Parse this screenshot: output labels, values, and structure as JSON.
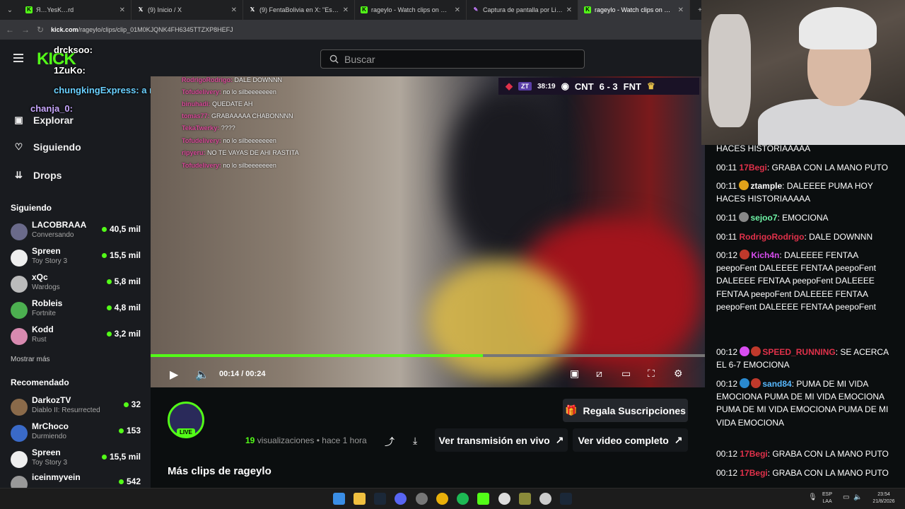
{
  "browser": {
    "tabs": [
      {
        "title": "Я…YesK…rd",
        "icon": "kick-icon",
        "active": false
      },
      {
        "title": "(9) Inicio / X",
        "icon": "x-icon",
        "active": false
      },
      {
        "title": "(9) FentaBolivia en X: \"Este tipo…",
        "icon": "x-icon",
        "active": false
      },
      {
        "title": "rageylo - Watch clips on Kick",
        "icon": "kick-icon",
        "active": false
      },
      {
        "title": "Captura de pantalla por Lightsh…",
        "icon": "lightshot-icon",
        "active": false
      },
      {
        "title": "rageylo - Watch clips on Kick",
        "icon": "kick-icon",
        "active": true
      }
    ],
    "url_host": "kick.com",
    "url_path": "/rageylo/clips/clip_01M0KJQNK4FH6345TTZXP8HEFJ",
    "new_tab": "+"
  },
  "overlay": {
    "users": [
      "drcksoo:",
      "1ZuKo:",
      "chungkingExpress: a no",
      "chanja_0:"
    ],
    "logo": "KICK"
  },
  "search": {
    "placeholder": "Buscar"
  },
  "nav": {
    "explore": "Explorar",
    "following": "Siguiendo",
    "drops": "Drops"
  },
  "following": {
    "title": "Siguiendo",
    "channels": [
      {
        "name": "LACOBRAAA",
        "game": "Conversando",
        "viewers": "40,5 mil"
      },
      {
        "name": "Spreen",
        "game": "Toy Story 3",
        "viewers": "15,5 mil"
      },
      {
        "name": "xQc",
        "game": "Wardogs",
        "viewers": "5,8 mil"
      },
      {
        "name": "Robleis",
        "game": "Fortnite",
        "viewers": "4,8 mil"
      },
      {
        "name": "Kodd",
        "game": "Rust",
        "viewers": "3,2 mil"
      }
    ],
    "show_more": "Mostrar más"
  },
  "recommended": {
    "title": "Recomendado",
    "channels": [
      {
        "name": "DarkozTV",
        "game": "Diablo II: Resurrected",
        "viewers": "32"
      },
      {
        "name": "MrChoco",
        "game": "Durmiendo",
        "viewers": "153"
      },
      {
        "name": "Spreen",
        "game": "Toy Story 3",
        "viewers": "15,5 mil"
      },
      {
        "name": "iceinmyvein",
        "game": "",
        "viewers": "542"
      }
    ]
  },
  "video": {
    "time": "00:14 / 00:24",
    "progress": 0.6,
    "scoreboard": {
      "timer": "38:19",
      "team1": "CNT",
      "score": "6 - 3",
      "team2": "FNT",
      "tag": "ZT"
    },
    "chat_overlay": [
      {
        "user": "RodrigoRodrigo:",
        "text": "DALE DOWNNN"
      },
      {
        "user": "Tofudelivery:",
        "text": "no lo silbeeeeeeen"
      },
      {
        "user": "binuhadi:",
        "text": "QUEDATE AH"
      },
      {
        "user": "tomas77:",
        "text": "GRABAAAAA CHABONNNN"
      },
      {
        "user": "TekaTwerky:",
        "text": "????"
      },
      {
        "user": "Tofudelivery:",
        "text": "no lo silbeeeeeeen"
      },
      {
        "user": "ripyeru:",
        "text": "NO TE VAYAS DE AHI RASTITA"
      },
      {
        "user": "Tofudelivery:",
        "text": "no lo silbeeeeeeen"
      }
    ]
  },
  "clip": {
    "views": "19",
    "views_label": "visualizaciones",
    "ago": "• hace 1 hora",
    "gift_btn": "Regala Suscripciones",
    "live_btn": "Ver transmisión en vivo",
    "full_btn": "Ver video completo",
    "live_badge": "LIVE",
    "more_clips": "Más clips de rageylo"
  },
  "chat": {
    "messages": [
      {
        "time": "",
        "user": "",
        "text": "HACES HISTORIAAAAA",
        "color": "white"
      },
      {
        "time": "00:11",
        "user": "17Begi",
        "text": ": GRABA CON LA MANO PUTO",
        "color": "red"
      },
      {
        "time": "00:11",
        "user": "ztample",
        "text": ": DALEEEE PUMA HOY HACES HISTORIAAAAA",
        "color": "white"
      },
      {
        "time": "00:11",
        "user": "sejoo7",
        "text": ": EMOCIONA",
        "color": "green"
      },
      {
        "time": "00:11",
        "user": "RodrigoRodrigo",
        "text": ": DALE DOWNNN",
        "color": "red"
      },
      {
        "time": "00:12",
        "user": "Kich4n",
        "text": ": DALEEEE FENTAA peepoFent DALEEEE FENTAA peepoFent DALEEEE FENTAA peepoFent DALEEEE FENTAA peepoFent DALEEEE FENTAA peepoFent DALEEEE FENTAA peepoFent",
        "color": "magenta"
      },
      {
        "time": "00:12",
        "user": "SPEED_RUNNING",
        "text": ": SE ACERCA EL 6-7 EMOCIONA",
        "color": "red"
      },
      {
        "time": "00:12",
        "user": "sand84",
        "text": ": PUMA DE MI VIDA EMOCIONA PUMA DE MI VIDA EMOCIONA PUMA DE MI VIDA EMOCIONA PUMA DE MI VIDA EMOCIONA",
        "color": "blue"
      },
      {
        "time": "00:12",
        "user": "17Begi",
        "text": ": GRABA CON LA MANO PUTO",
        "color": "red"
      },
      {
        "time": "00:12",
        "user": "17Begi",
        "text": ": GRABA CON LA MANO PUTO",
        "color": "red"
      }
    ]
  },
  "taskbar": {
    "lang": "ESP",
    "region": "LAA",
    "time": "23:54",
    "date": "21/8/2026"
  },
  "colors": {
    "accent": "#53fc18",
    "bg": "#0b0e0f",
    "sidebar": "#191b1f"
  }
}
